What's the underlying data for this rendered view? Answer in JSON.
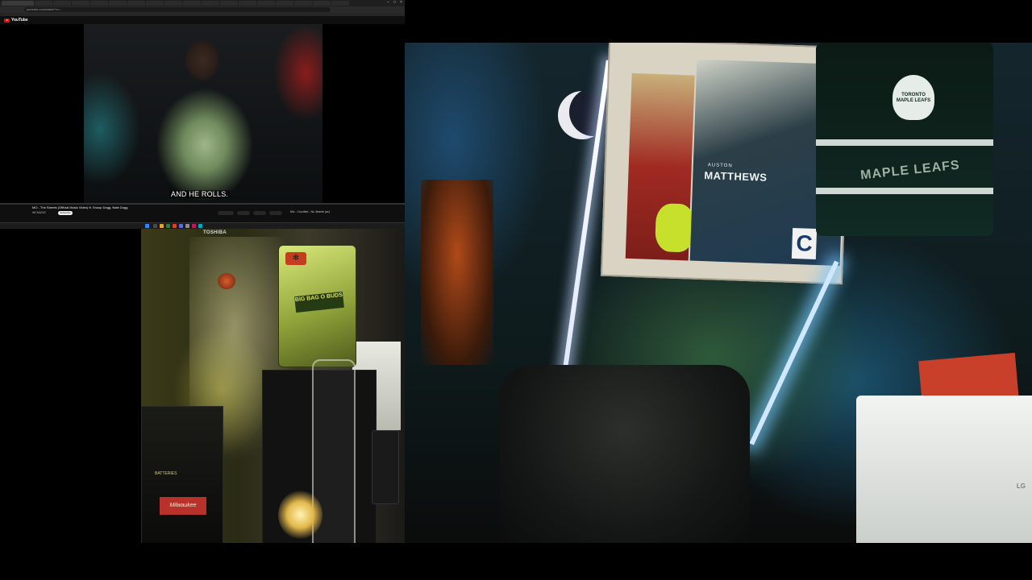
{
  "browser": {
    "tabs": [
      "",
      "",
      "",
      "",
      "",
      "",
      "",
      "",
      "",
      "",
      "",
      "",
      "",
      "",
      "",
      "",
      "",
      "",
      "",
      "",
      "",
      ""
    ],
    "url": "youtube.com/watch?v=...",
    "site_name": "YouTube"
  },
  "video": {
    "subtitle": "AND HE ROLLS.",
    "title": "MO - The Streets (Official Music Video) ft. Snoop Dogg, Nate Dogg",
    "channel": "WCMUSIC",
    "subscribe_label": "Subscribe",
    "next_up": "Mix - Crucified - No Jimmie (ac)",
    "progress": 0.0
  },
  "webcam": {
    "title": "TOSHIBA"
  },
  "room": {
    "poster_name_small": "AUSTON",
    "poster_name": "MATTHEWS",
    "poster_captain": "C",
    "jersey_crest": "TORONTO MAPLE LEAFS",
    "jersey_word": "MAPLE LEAFS",
    "bag_label": "BIG BAG O BUDS",
    "tin_small": "BATTERIES",
    "tin_brand": "Milwaukee",
    "washer_brand": "LG"
  },
  "colors": {
    "youtube_red": "#ff0000",
    "taskbar_start": "#3b82f6"
  }
}
